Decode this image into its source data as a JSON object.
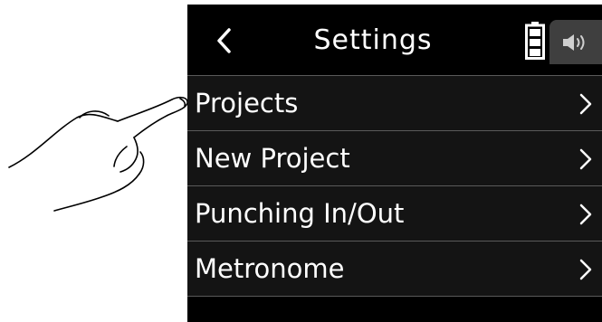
{
  "header": {
    "title": "Settings",
    "back_icon": "chevron-left-icon",
    "battery_icon": "battery-icon",
    "speaker_icon": "speaker-icon"
  },
  "menu": {
    "items": [
      {
        "label": "Projects",
        "icon": "chevron-right-icon"
      },
      {
        "label": "New Project",
        "icon": "chevron-right-icon"
      },
      {
        "label": "Punching In/Out",
        "icon": "chevron-right-icon"
      },
      {
        "label": "Metronome",
        "icon": "chevron-right-icon"
      }
    ]
  },
  "colors": {
    "screen_background": "#000000",
    "row_background": "#141414",
    "divider": "#5a5a5a",
    "speaker_button": "#3f3f3f",
    "text": "#ffffff"
  }
}
